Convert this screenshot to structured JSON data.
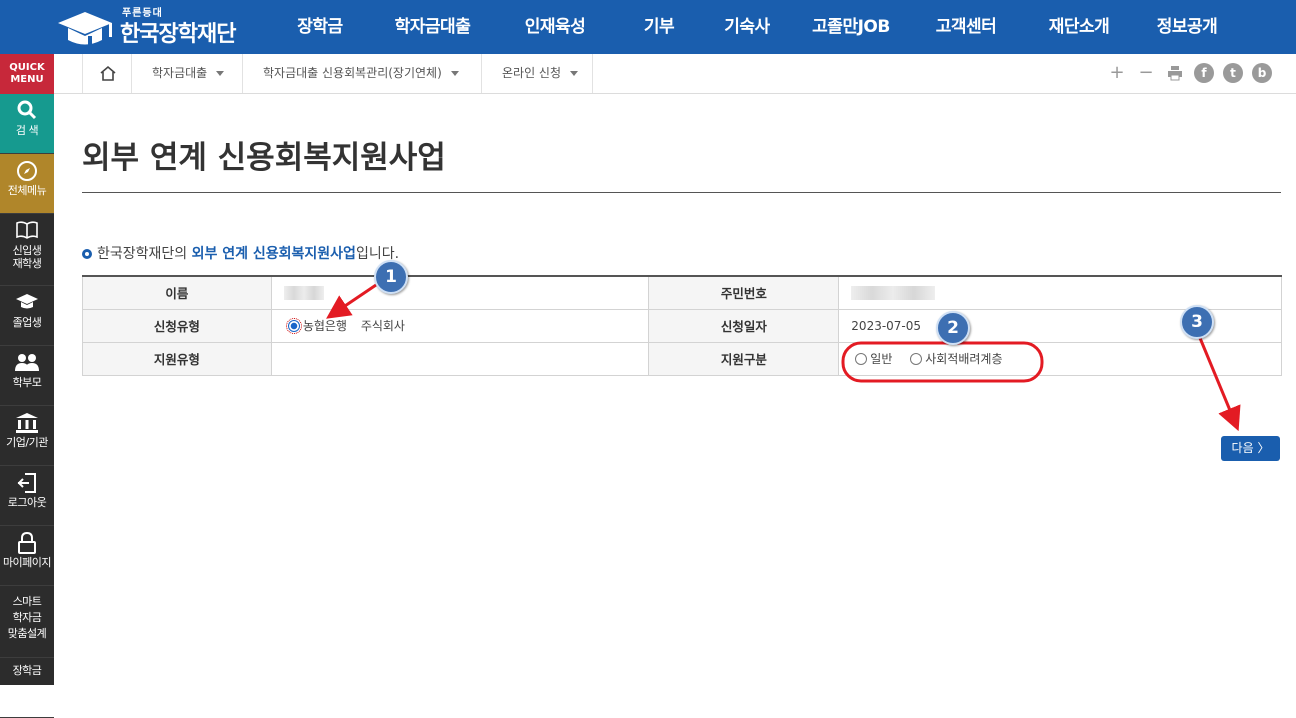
{
  "header": {
    "logo_sub": "푸른등대",
    "logo_name": "한국장학재단",
    "nav": [
      "장학금",
      "학자금대출",
      "인재육성",
      "기부",
      "기숙사",
      "고졸만JOB",
      "고객센터",
      "재단소개",
      "정보공개"
    ]
  },
  "quick_menu": {
    "title_line1": "QUICK",
    "title_line2": "MENU",
    "items": [
      {
        "label": "검 색",
        "icon": "search-icon"
      },
      {
        "label": "전체메뉴",
        "icon": "compass-icon"
      },
      {
        "label1": "신입생",
        "label2": "재학생",
        "icon": "book-icon"
      },
      {
        "label": "졸업생",
        "icon": "graduation-cap-icon"
      },
      {
        "label": "학부모",
        "icon": "parents-icon"
      },
      {
        "label": "기업/기관",
        "icon": "institution-icon"
      },
      {
        "label": "로그아웃",
        "icon": "logout-icon"
      },
      {
        "label": "마이페이지",
        "icon": "lock-icon"
      },
      {
        "label1": "스마트",
        "label2": "학자금",
        "label3": "맞춤설계"
      },
      {
        "label": "장학금"
      }
    ]
  },
  "breadcrumb": {
    "items": [
      "학자금대출",
      "학자금대출 신용회복관리(장기연체)",
      "온라인 신청"
    ]
  },
  "page": {
    "title": "외부 연계 신용회복지원사업",
    "intro_prefix": "한국장학재단의 ",
    "intro_highlight": "외부 연계 신용회복지원사업",
    "intro_suffix": "입니다."
  },
  "form": {
    "name_label": "이름",
    "rrn_label": "주민번호",
    "apply_type_label": "신청유형",
    "apply_type_selected": "농협은행",
    "apply_type_company": "주식회사",
    "apply_date_label": "신청일자",
    "apply_date": "2023-07-05",
    "support_type_label": "지원유형",
    "support_category_label": "지원구분",
    "option_general": "일반",
    "option_social": "사회적배려계층"
  },
  "buttons": {
    "next": "다음 〉"
  },
  "annotations": {
    "badge1": "1",
    "badge2": "2",
    "badge3": "3",
    "annotation_color": "#e31b23"
  }
}
